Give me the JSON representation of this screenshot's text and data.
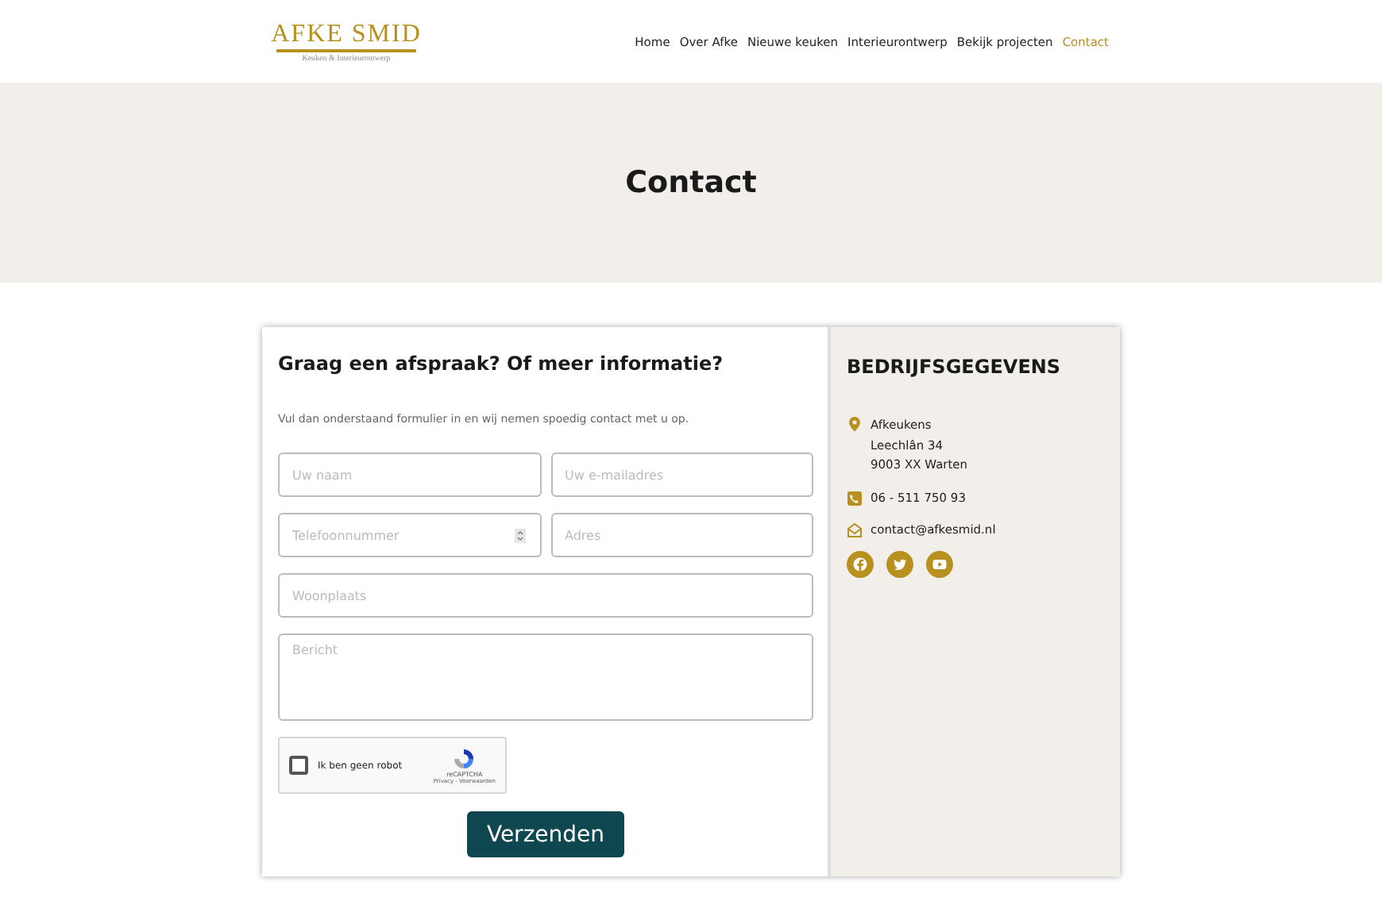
{
  "logo": {
    "title": "AFKE SMID",
    "subtitle": "Keuken & Interieurontwerp"
  },
  "nav": [
    {
      "label": "Home",
      "selected": false
    },
    {
      "label": "Over Afke",
      "selected": false
    },
    {
      "label": "Nieuwe keuken",
      "selected": false
    },
    {
      "label": "Interieurontwerp",
      "selected": false
    },
    {
      "label": "Bekijk projecten",
      "selected": false
    },
    {
      "label": "Contact",
      "selected": true
    }
  ],
  "hero": {
    "title": "Contact"
  },
  "form": {
    "heading": "Graag een afspraak? Of meer informatie?",
    "intro": "Vul dan onderstaand formulier in en wij nemen spoedig contact met u op.",
    "fields": [
      {
        "placeholder": "Uw naam",
        "kind": "text"
      },
      {
        "placeholder": "Uw e-mailadres",
        "kind": "text"
      },
      {
        "placeholder": "Telefoonnummer",
        "kind": "number"
      },
      {
        "placeholder": "Adres",
        "kind": "text"
      },
      {
        "placeholder": "Woonplaats",
        "kind": "wide"
      },
      {
        "placeholder": "Bericht",
        "kind": "textarea"
      }
    ],
    "captcha": {
      "label": "Ik ben geen robot",
      "checked": false,
      "brand": "reCAPTCHA",
      "links": "Privacy - Voorwaarden"
    },
    "submit": "Verzenden"
  },
  "company": {
    "heading": "BEDRIJFSGEGEVENS",
    "address": [
      "Afkeukens",
      "Leechlân 34",
      "9003 XX Warten"
    ],
    "phone": "06 - 511 750 93",
    "email": "contact@afkesmid.nl",
    "social": [
      {
        "kind": "facebook"
      },
      {
        "kind": "twitter"
      },
      {
        "kind": "youtube"
      }
    ]
  }
}
